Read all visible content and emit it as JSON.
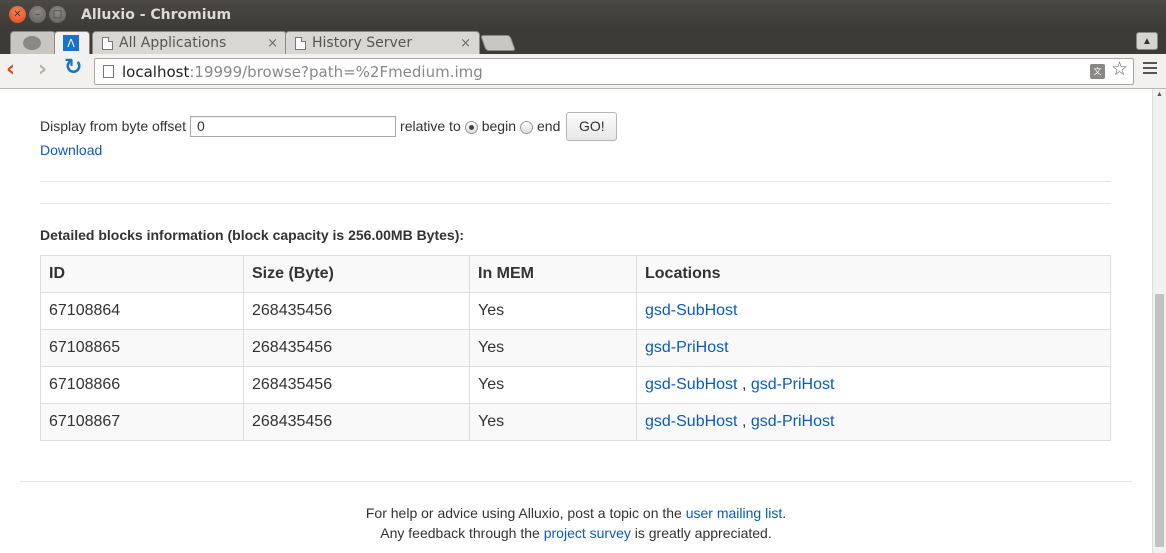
{
  "window": {
    "title": "Alluxio - Chromium"
  },
  "tabs": [
    {
      "label": "",
      "active": true
    },
    {
      "label": "All Applications",
      "close": "×"
    },
    {
      "label": "History Server",
      "close": "×"
    }
  ],
  "toolbar": {
    "url_host": "localhost",
    "url_rest": ":19999/browse?path=%2Fmedium.img"
  },
  "offset_form": {
    "label": "Display from byte offset",
    "value": "0",
    "relative_to": "relative to",
    "begin_label": "begin",
    "end_label": "end",
    "selected": "begin",
    "go_label": "GO!"
  },
  "download_label": "Download",
  "blocks": {
    "heading": "Detailed blocks information (block capacity is 256.00MB Bytes):",
    "headers": [
      "ID",
      "Size (Byte)",
      "In MEM",
      "Locations"
    ],
    "rows": [
      {
        "id": "67108864",
        "size": "268435456",
        "in_mem": "Yes",
        "locations": [
          "gsd-SubHost"
        ]
      },
      {
        "id": "67108865",
        "size": "268435456",
        "in_mem": "Yes",
        "locations": [
          "gsd-PriHost"
        ]
      },
      {
        "id": "67108866",
        "size": "268435456",
        "in_mem": "Yes",
        "locations": [
          "gsd-SubHost",
          "gsd-PriHost"
        ]
      },
      {
        "id": "67108867",
        "size": "268435456",
        "in_mem": "Yes",
        "locations": [
          "gsd-SubHost",
          "gsd-PriHost"
        ]
      }
    ]
  },
  "footer": {
    "line1_prefix": "For help or advice using Alluxio, post a topic on the ",
    "line1_link": "user mailing list",
    "line1_suffix": ".",
    "line2_prefix": "Any feedback through the ",
    "line2_link": "project survey",
    "line2_suffix": " is greatly appreciated."
  },
  "colors": {
    "link": "#0b5bbb",
    "close_button": "#df4a16",
    "titlebar": "#3c3b37"
  }
}
